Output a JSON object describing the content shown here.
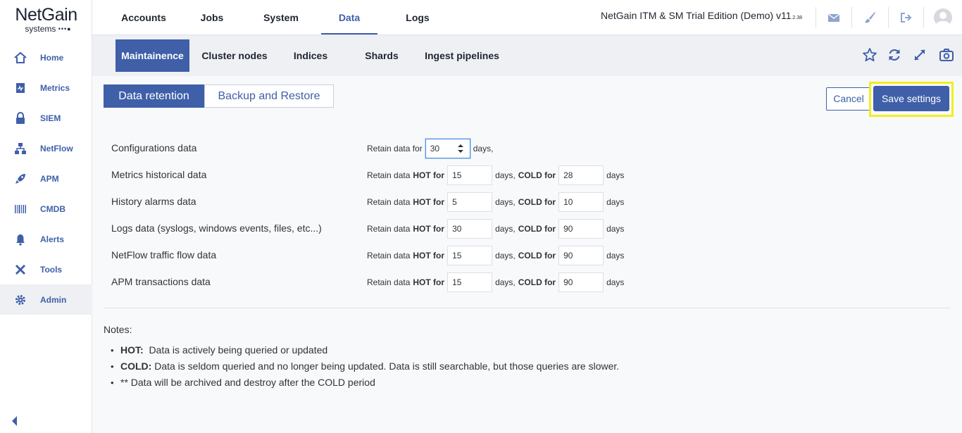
{
  "logo": {
    "main": "NetGain",
    "sub": "systems",
    "dots": "•••●"
  },
  "sidebar": {
    "items": [
      {
        "label": "Home",
        "icon": "home-icon"
      },
      {
        "label": "Metrics",
        "icon": "metrics-icon"
      },
      {
        "label": "SIEM",
        "icon": "lock-icon"
      },
      {
        "label": "NetFlow",
        "icon": "network-icon"
      },
      {
        "label": "APM",
        "icon": "rocket-icon"
      },
      {
        "label": "CMDB",
        "icon": "barcode-icon"
      },
      {
        "label": "Alerts",
        "icon": "bell-icon"
      },
      {
        "label": "Tools",
        "icon": "tools-icon"
      },
      {
        "label": "Admin",
        "icon": "gear-icon",
        "active": true
      }
    ]
  },
  "topnav": {
    "tabs": [
      {
        "label": "Accounts"
      },
      {
        "label": "Jobs"
      },
      {
        "label": "System"
      },
      {
        "label": "Data",
        "active": true
      },
      {
        "label": "Logs"
      }
    ],
    "edition": "NetGain ITM & SM Trial Edition (Demo) v11",
    "version_sub": ".2.38"
  },
  "subnav": {
    "tabs": [
      {
        "label": "Maintainence",
        "active": true
      },
      {
        "label": "Cluster nodes"
      },
      {
        "label": "Indices"
      },
      {
        "label": "Shards"
      },
      {
        "label": "Ingest pipelines"
      }
    ]
  },
  "segments": {
    "retention": "Data retention",
    "backup": "Backup and Restore"
  },
  "actions": {
    "cancel": "Cancel",
    "save": "Save settings"
  },
  "labels": {
    "retain_for": "Retain data for",
    "retain_data": "Retain data",
    "hot_for": "HOT for",
    "cold_for": "COLD for",
    "days_comma": "days,",
    "days": "days"
  },
  "rows": [
    {
      "label": "Configurations data",
      "value": "30"
    },
    {
      "label": "Metrics historical data",
      "hot": "15",
      "cold": "28"
    },
    {
      "label": "History alarms data",
      "hot": "5",
      "cold": "10"
    },
    {
      "label": "Logs data (syslogs, windows events, files, etc...)",
      "hot": "30",
      "cold": "90"
    },
    {
      "label": "NetFlow traffic flow data",
      "hot": "15",
      "cold": "90"
    },
    {
      "label": "APM transactions data",
      "hot": "15",
      "cold": "90"
    }
  ],
  "notes": {
    "title": "Notes:",
    "items": [
      {
        "term": "HOT:",
        "text": "  Data is actively being queried or updated"
      },
      {
        "term": "COLD:",
        "text": " Data is seldom queried and no longer being updated. Data is still searchable, but those queries are slower."
      },
      {
        "term": "",
        "text": "** Data will be archived and destroy after the COLD period"
      }
    ]
  },
  "colors": {
    "accent": "#3f5fa8",
    "highlight": "#f2ee1f"
  }
}
